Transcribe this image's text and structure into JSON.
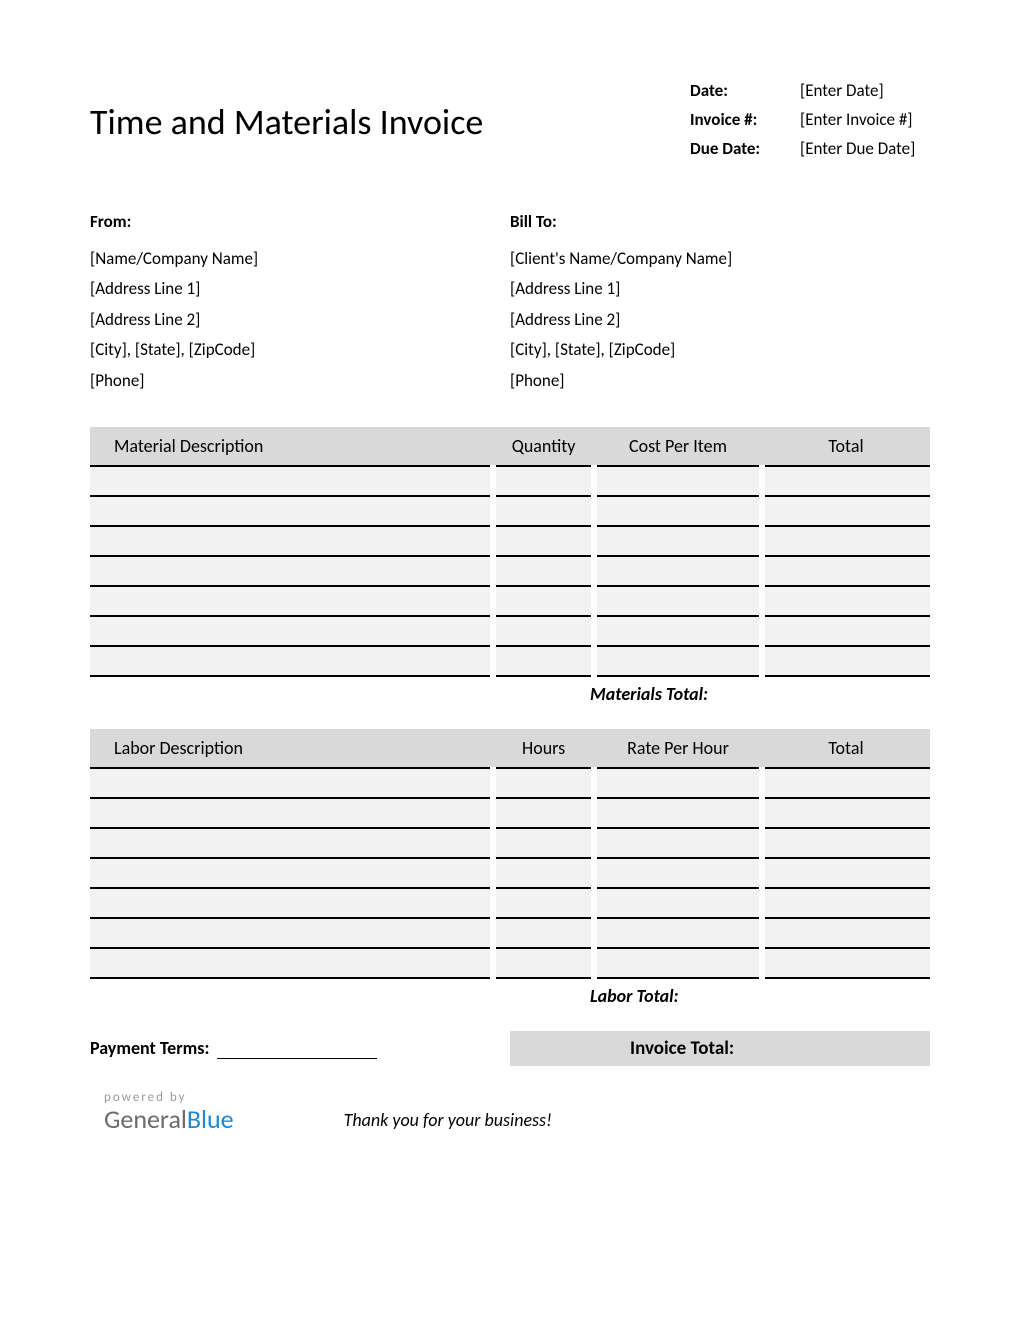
{
  "title": "Time and Materials Invoice",
  "meta": {
    "date_label": "Date:",
    "date_value": "[Enter Date]",
    "invoice_label": "Invoice #:",
    "invoice_value": "[Enter Invoice #]",
    "due_label": "Due Date:",
    "due_value": "[Enter Due Date]"
  },
  "from": {
    "heading": "From:",
    "lines": [
      "[Name/Company Name]",
      "[Address Line 1]",
      "[Address Line 2]",
      "[City], [State], [ZipCode]",
      "[Phone]"
    ]
  },
  "bill_to": {
    "heading": "Bill To:",
    "lines": [
      "[Client's Name/Company Name]",
      "[Address Line 1]",
      "[Address Line 2]",
      "[City], [State], [ZipCode]",
      "[Phone]"
    ]
  },
  "materials": {
    "headers": [
      "Material Description",
      "Quantity",
      "Cost Per Item",
      "Total"
    ],
    "rows": [
      [
        "",
        "",
        "",
        ""
      ],
      [
        "",
        "",
        "",
        ""
      ],
      [
        "",
        "",
        "",
        ""
      ],
      [
        "",
        "",
        "",
        ""
      ],
      [
        "",
        "",
        "",
        ""
      ],
      [
        "",
        "",
        "",
        ""
      ],
      [
        "",
        "",
        "",
        ""
      ]
    ],
    "subtotal_label": "Materials Total:"
  },
  "labor": {
    "headers": [
      "Labor Description",
      "Hours",
      "Rate Per Hour",
      "Total"
    ],
    "rows": [
      [
        "",
        "",
        "",
        ""
      ],
      [
        "",
        "",
        "",
        ""
      ],
      [
        "",
        "",
        "",
        ""
      ],
      [
        "",
        "",
        "",
        ""
      ],
      [
        "",
        "",
        "",
        ""
      ],
      [
        "",
        "",
        "",
        ""
      ],
      [
        "",
        "",
        "",
        ""
      ]
    ],
    "subtotal_label": "Labor Total:"
  },
  "payment_terms_label": "Payment Terms:",
  "invoice_total_label": "Invoice Total:",
  "powered_by": "powered by",
  "brand_general": "General",
  "brand_blue": "Blue",
  "thanks": "Thank you for your business!"
}
